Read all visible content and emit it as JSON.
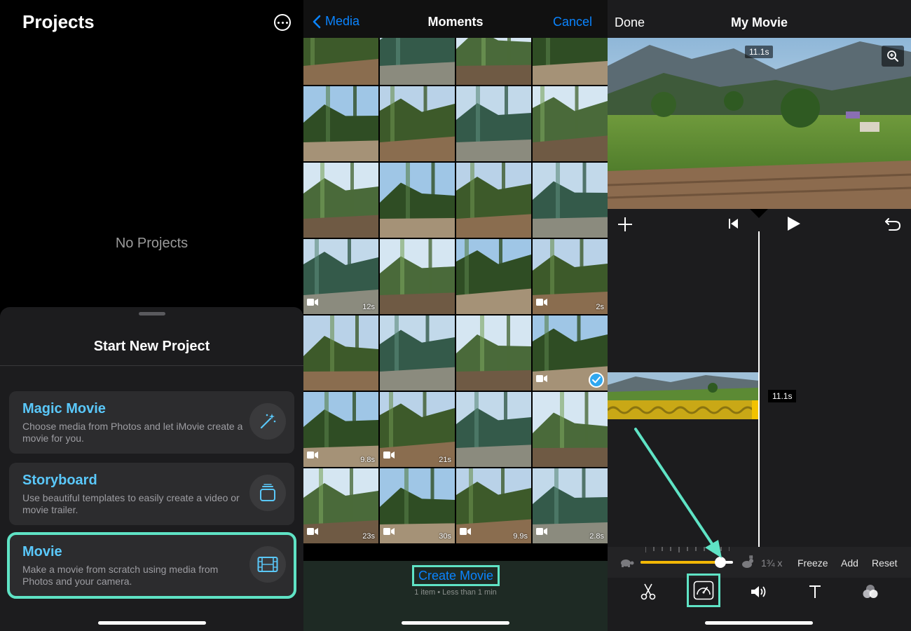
{
  "projects": {
    "title": "Projects",
    "empty_text": "No Projects",
    "sheet": {
      "title": "Start New Project",
      "options": [
        {
          "title": "Magic Movie",
          "description": "Choose media from Photos and let iMovie create a movie for you.",
          "icon": "magic-wand-icon"
        },
        {
          "title": "Storyboard",
          "description": "Use beautiful templates to easily create a video or movie trailer.",
          "icon": "storyboard-icon"
        },
        {
          "title": "Movie",
          "description": "Make a movie from scratch using media from Photos and your camera.",
          "icon": "film-icon"
        }
      ]
    }
  },
  "media": {
    "back_label": "Media",
    "title": "Moments",
    "cancel_label": "Cancel",
    "thumbs": [
      {
        "video": false,
        "duration": ""
      },
      {
        "video": false,
        "duration": ""
      },
      {
        "video": false,
        "duration": ""
      },
      {
        "video": false,
        "duration": ""
      },
      {
        "video": false,
        "duration": ""
      },
      {
        "video": false,
        "duration": ""
      },
      {
        "video": false,
        "duration": ""
      },
      {
        "video": false,
        "duration": ""
      },
      {
        "video": false,
        "duration": ""
      },
      {
        "video": false,
        "duration": ""
      },
      {
        "video": false,
        "duration": ""
      },
      {
        "video": false,
        "duration": ""
      },
      {
        "video": true,
        "duration": "12s"
      },
      {
        "video": false,
        "duration": ""
      },
      {
        "video": false,
        "duration": ""
      },
      {
        "video": true,
        "duration": "2s"
      },
      {
        "video": false,
        "duration": ""
      },
      {
        "video": false,
        "duration": ""
      },
      {
        "video": false,
        "duration": ""
      },
      {
        "video": true,
        "duration": "",
        "selected": true
      },
      {
        "video": true,
        "duration": "9.8s"
      },
      {
        "video": true,
        "duration": "21s"
      },
      {
        "video": false,
        "duration": ""
      },
      {
        "video": false,
        "duration": ""
      },
      {
        "video": true,
        "duration": "23s"
      },
      {
        "video": true,
        "duration": "30s"
      },
      {
        "video": true,
        "duration": "9.9s"
      },
      {
        "video": true,
        "duration": "2.8s"
      }
    ],
    "create_label": "Create Movie",
    "create_sub": "1 item • Less than 1 min"
  },
  "editor": {
    "done_label": "Done",
    "title": "My Movie",
    "viewer_duration": "11.1s",
    "clip_duration": "11.1s",
    "speed_label": "1¾ x",
    "speed_level": 0.86,
    "freeze_label": "Freeze",
    "add_label": "Add",
    "reset_label": "Reset",
    "accent": "#5fe3c5"
  }
}
